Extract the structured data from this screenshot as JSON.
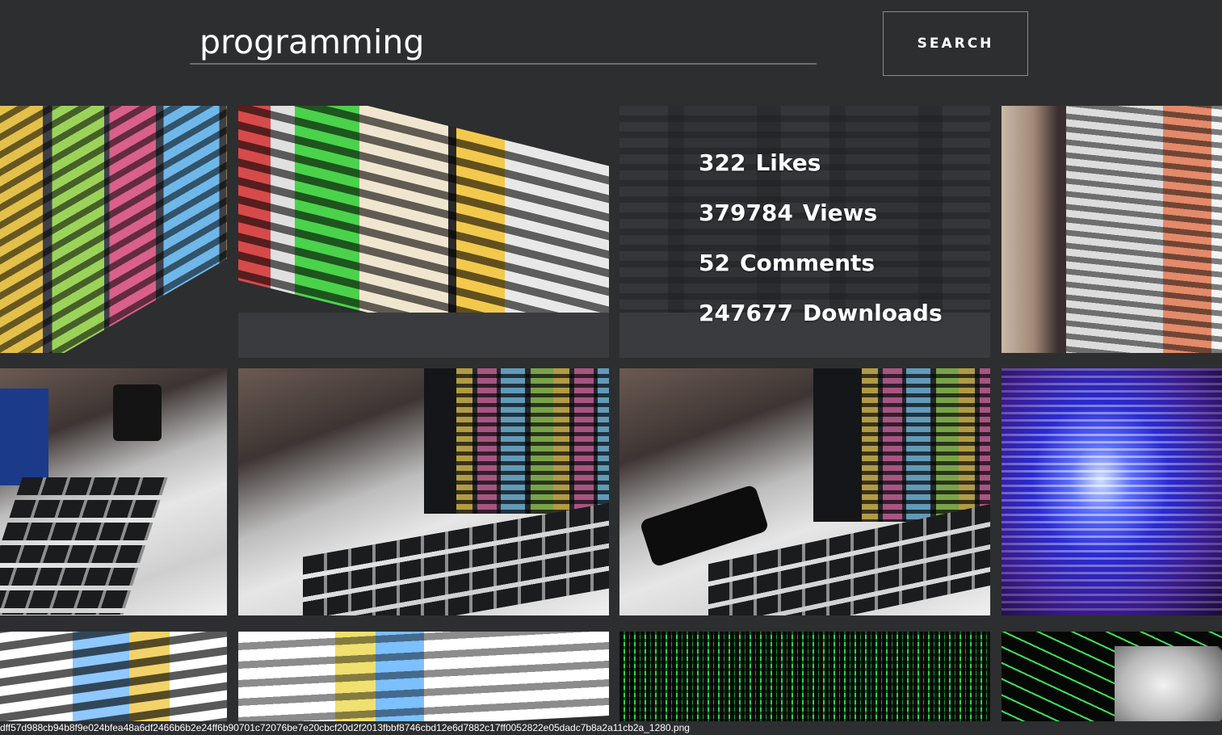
{
  "search": {
    "query": "programming",
    "button_label": "SEARCH"
  },
  "hovered_image": {
    "likes_value": "322",
    "likes_label": "Likes",
    "views_value": "379784",
    "views_label": "Views",
    "comments_value": "52",
    "comments_label": "Comments",
    "downloads_value": "247677",
    "downloads_label": "Downloads"
  },
  "footer": {
    "filename": "dff57d988cb94b8f9e024bfea48a6df2466b6b2e24ff6b90701c72076be7e20cbcf20d2f2013fbbf8746cbd12e6d7882c17ff0052822e05dadc7b8a2a11cb2a_1280.png"
  },
  "colors": {
    "background": "#2d2e30",
    "tile_footer": "#3a3b3e",
    "input_underline": "#6b6c6f"
  }
}
